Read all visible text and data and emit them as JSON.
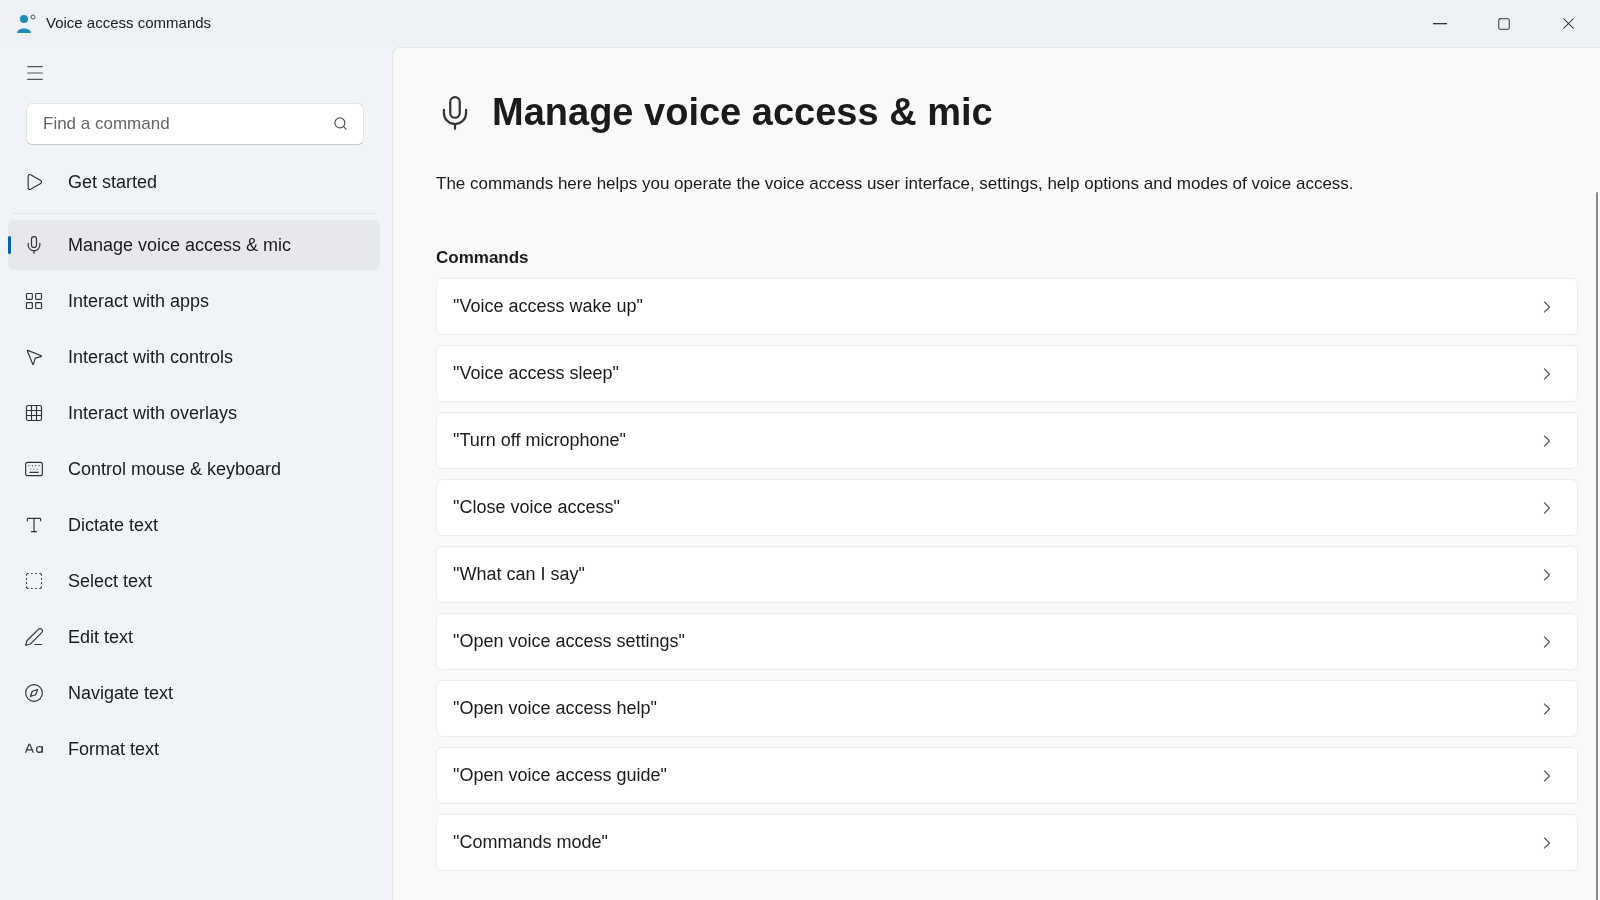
{
  "window": {
    "title": "Voice access commands"
  },
  "search": {
    "placeholder": "Find a command"
  },
  "sidebar": {
    "items": [
      {
        "label": "Get started",
        "selected": false
      },
      {
        "label": "Manage voice access & mic",
        "selected": true
      },
      {
        "label": "Interact with apps",
        "selected": false
      },
      {
        "label": "Interact with controls",
        "selected": false
      },
      {
        "label": "Interact with overlays",
        "selected": false
      },
      {
        "label": "Control mouse & keyboard",
        "selected": false
      },
      {
        "label": "Dictate text",
        "selected": false
      },
      {
        "label": "Select text",
        "selected": false
      },
      {
        "label": "Edit text",
        "selected": false
      },
      {
        "label": "Navigate text",
        "selected": false
      },
      {
        "label": "Format text",
        "selected": false
      }
    ]
  },
  "page": {
    "title": "Manage voice access & mic",
    "description": "The commands here helps you operate the voice access user interface, settings, help options and modes of voice access.",
    "section": "Commands",
    "commands": [
      "\"Voice access wake up\"",
      "\"Voice access sleep\"",
      "\"Turn off microphone\"",
      "\"Close voice access\"",
      "\"What can I say\"",
      "\"Open voice access settings\"",
      "\"Open voice access help\"",
      "\"Open voice access guide\"",
      "\"Commands mode\""
    ]
  }
}
